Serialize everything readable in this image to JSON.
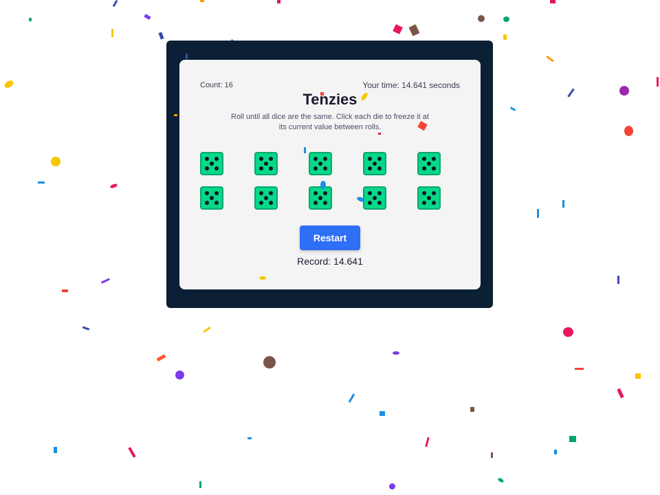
{
  "game": {
    "count_label": "Count: 16",
    "time_label": "Your time: 14.641 seconds",
    "title": "Tenzies",
    "instructions": "Roll until all dice are the same. Click each die to freeze it at its current value between rolls.",
    "dice": [
      {
        "value": 5,
        "held": false
      },
      {
        "value": 5,
        "held": false
      },
      {
        "value": 5,
        "held": false
      },
      {
        "value": 5,
        "held": false
      },
      {
        "value": 5,
        "held": false
      },
      {
        "value": 5,
        "held": false
      },
      {
        "value": 5,
        "held": false
      },
      {
        "value": 5,
        "held": false
      },
      {
        "value": 5,
        "held": false
      },
      {
        "value": 5,
        "held": false
      }
    ],
    "restart_label": "Restart",
    "record_label": "Record: 14.641"
  },
  "colors": {
    "background": "#ffffff",
    "frame": "#0b2034",
    "card": "#f4f4f4",
    "die_face": "#05d888",
    "pip": "#0e1725",
    "button": "#2f6ff6",
    "confetti": [
      "#e8175d",
      "#f7c600",
      "#1a8fe3",
      "#7c3aed",
      "#795548",
      "#f44336",
      "#00a86b",
      "#ff9800"
    ]
  }
}
